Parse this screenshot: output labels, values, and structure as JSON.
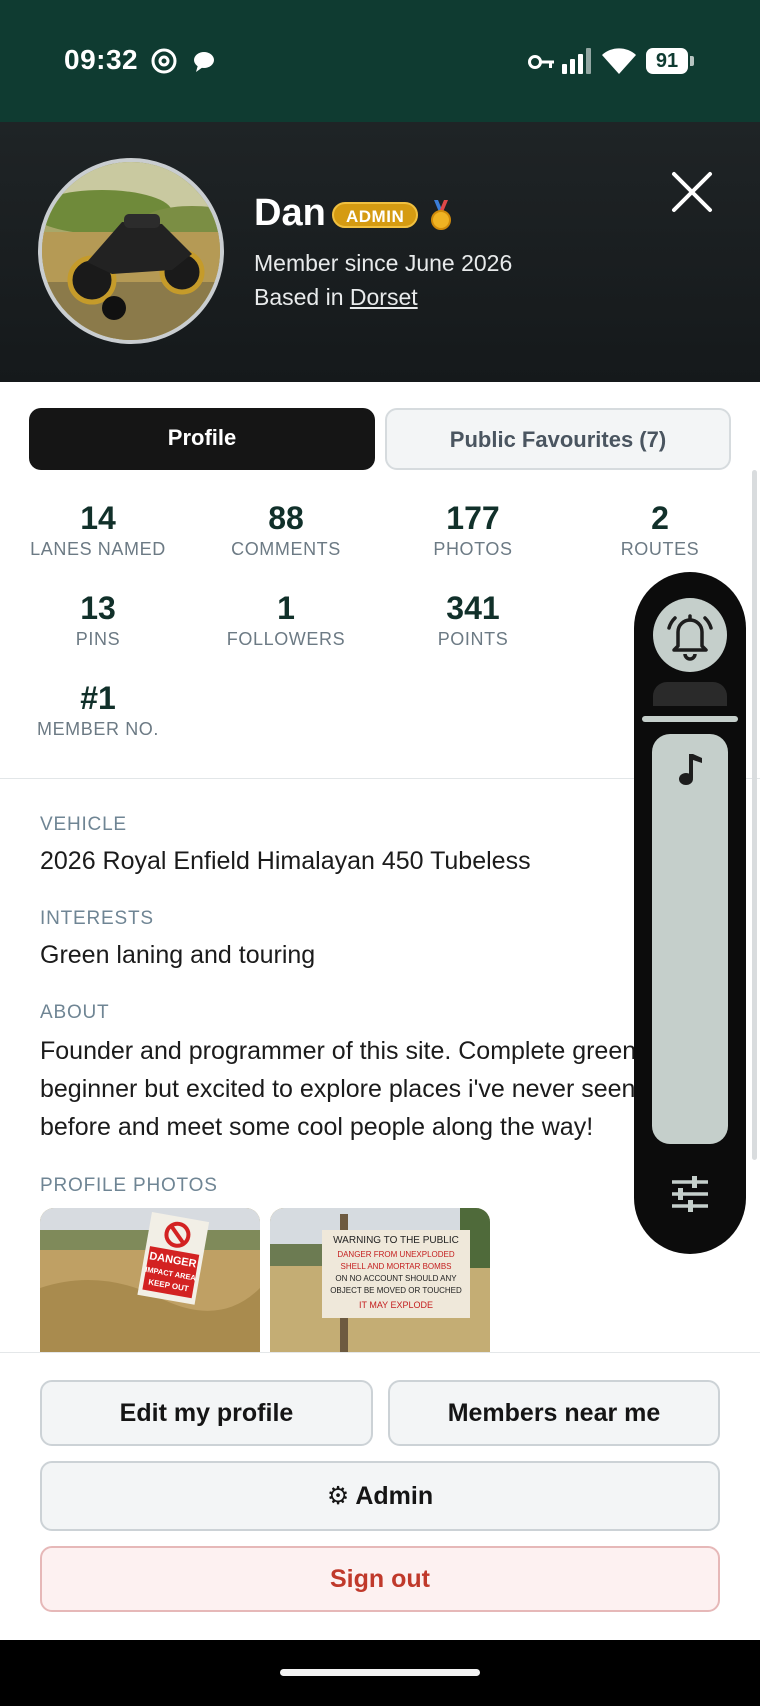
{
  "status_bar": {
    "time": "09:32",
    "battery": "91"
  },
  "profile": {
    "name": "Dan",
    "badge": "ADMIN",
    "member_since": "Member since June 2026",
    "based_in_prefix": "Based in",
    "location": "Dorset"
  },
  "tabs": [
    {
      "label": "Profile",
      "active": true
    },
    {
      "label": "Public Favourites (7)",
      "active": false
    }
  ],
  "stats": [
    {
      "value": "14",
      "label": "LANES NAMED"
    },
    {
      "value": "88",
      "label": "COMMENTS"
    },
    {
      "value": "177",
      "label": "PHOTOS"
    },
    {
      "value": "2",
      "label": "ROUTES"
    },
    {
      "value": "13",
      "label": "PINS"
    },
    {
      "value": "1",
      "label": "FOLLOWERS"
    },
    {
      "value": "341",
      "label": "POINTS"
    },
    {
      "value": "#1",
      "label": "MEMBER NO."
    }
  ],
  "details": {
    "vehicle_label": "VEHICLE",
    "vehicle": "2026 Royal Enfield Himalayan 450 Tubeless",
    "interests_label": "INTERESTS",
    "interests": "Green laning and touring",
    "about_label": "ABOUT",
    "about_lines": [
      "Founder and programmer of this site. Complete green",
      "beginner but excited to explore places i've never seen",
      "before and meet some cool people along the way!"
    ],
    "photos_label": "PROFILE PHOTOS"
  },
  "photo_signs": {
    "photo1": [
      "DANGER",
      "IMPACT AREA",
      "KEEP OUT"
    ],
    "photo2": [
      "WARNING TO THE PUBLIC",
      "DANGER FROM UNEXPLODED",
      "SHELL AND MORTAR BOMBS",
      "ON NO ACCOUNT SHOULD ANY",
      "OBJECT BE MOVED OR TOUCHED",
      "IT MAY EXPLODE"
    ]
  },
  "actions": {
    "edit": "Edit my profile",
    "near": "Members near me",
    "admin": "⚙ Admin",
    "signout": "Sign out"
  },
  "colors": {
    "status_bar": "#0f3b31",
    "accent_badge": "#d59b12",
    "stat_number": "#11302a",
    "signout": "#c0392b"
  }
}
